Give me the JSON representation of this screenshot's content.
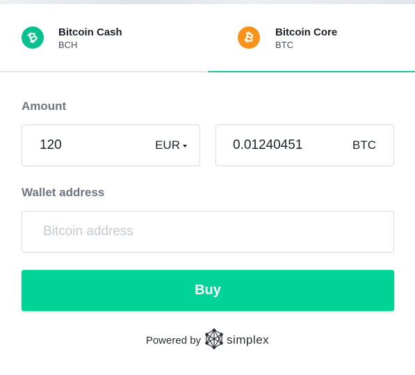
{
  "tabs": [
    {
      "name": "Bitcoin Cash",
      "code": "BCH",
      "icon": "bitcoin-cash-icon",
      "color": "#0ac18e",
      "selected": false
    },
    {
      "name": "Bitcoin Core",
      "code": "BTC",
      "icon": "bitcoin-icon",
      "color": "#f7931a",
      "selected": true
    }
  ],
  "form": {
    "amount_label": "Amount",
    "fiat_amount": "120",
    "fiat_currency": "EUR",
    "crypto_amount": "0.01240451",
    "crypto_currency": "BTC",
    "wallet_label": "Wallet address",
    "wallet_placeholder": "Bitcoin address",
    "wallet_value": ""
  },
  "buy_button": {
    "label": "Buy",
    "color": "#00d395"
  },
  "footer": {
    "powered_by": "Powered by",
    "brand": "simplex",
    "brand_icon": "simplex-logo-icon"
  },
  "colors": {
    "accent": "#1fc39c",
    "label": "#6e7684",
    "border": "#d9dcdf"
  }
}
